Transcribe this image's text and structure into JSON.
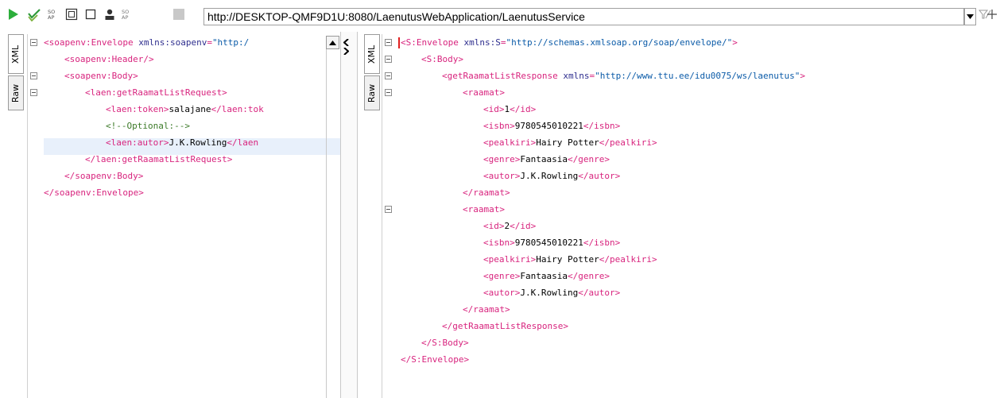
{
  "toolbar": {
    "url": "http://DESKTOP-QMF9D1U:8080/LaenutusWebApplication/LaenutusService",
    "icons": [
      "play-icon",
      "run-all-icon",
      "soap-icon",
      "xml-schema-icon",
      "square-icon",
      "user-icon",
      "soap-alt-icon",
      "stop-icon"
    ]
  },
  "request": {
    "tabs": [
      "XML",
      "Raw"
    ],
    "lines": [
      {
        "segments": [
          [
            "t",
            "<soapenv:Envelope "
          ],
          [
            "a",
            "xmlns:soapenv"
          ],
          [
            "t",
            "="
          ],
          [
            "v",
            "\"http:/"
          ]
        ]
      },
      {
        "segments": [
          [
            "t",
            "<soapenv:Header/>"
          ]
        ]
      },
      {
        "segments": [
          [
            "t",
            "<soapenv:Body>"
          ]
        ]
      },
      {
        "segments": [
          [
            "t",
            "<laen:getRaamatListRequest>"
          ]
        ]
      },
      {
        "segments": [
          [
            "t",
            "<laen:token>"
          ],
          [
            "x",
            "salajane"
          ],
          [
            "t",
            "</laen:tok"
          ]
        ]
      },
      {
        "segments": [
          [
            "c",
            "<!--Optional:-->"
          ]
        ]
      },
      {
        "segments": [
          [
            "t",
            "<laen:autor>"
          ],
          [
            "x",
            "J.K.Rowling"
          ],
          [
            "t",
            "</laen"
          ]
        ]
      },
      {
        "segments": [
          [
            "t",
            "</laen:getRaamatListRequest>"
          ]
        ]
      },
      {
        "segments": [
          [
            "t",
            "</soapenv:Body>"
          ]
        ]
      },
      {
        "segments": [
          [
            "t",
            "</soapenv:Envelope>"
          ]
        ]
      }
    ]
  },
  "response": {
    "tabs": [
      "XML",
      "Raw"
    ],
    "lines": [
      {
        "segments": [
          [
            "t",
            "<S:Envelope "
          ],
          [
            "a",
            "xmlns:S"
          ],
          [
            "t",
            "="
          ],
          [
            "v",
            "\"http://schemas.xmlsoap.org/soap/envelope/\""
          ],
          [
            "t",
            ">"
          ]
        ]
      },
      {
        "segments": [
          [
            "t",
            "<S:Body>"
          ]
        ]
      },
      {
        "segments": [
          [
            "t",
            "<getRaamatListResponse "
          ],
          [
            "a",
            "xmlns"
          ],
          [
            "t",
            "="
          ],
          [
            "v",
            "\"http://www.ttu.ee/idu0075/ws/laenutus\""
          ],
          [
            "t",
            ">"
          ]
        ]
      },
      {
        "segments": [
          [
            "t",
            "<raamat>"
          ]
        ]
      },
      {
        "segments": [
          [
            "t",
            "<id>"
          ],
          [
            "x",
            "1"
          ],
          [
            "t",
            "</id>"
          ]
        ]
      },
      {
        "segments": [
          [
            "t",
            "<isbn>"
          ],
          [
            "x",
            "9780545010221"
          ],
          [
            "t",
            "</isbn>"
          ]
        ]
      },
      {
        "segments": [
          [
            "t",
            "<pealkiri>"
          ],
          [
            "x",
            "Hairy Potter"
          ],
          [
            "t",
            "</pealkiri>"
          ]
        ]
      },
      {
        "segments": [
          [
            "t",
            "<genre>"
          ],
          [
            "x",
            "Fantaasia"
          ],
          [
            "t",
            "</genre>"
          ]
        ]
      },
      {
        "segments": [
          [
            "t",
            "<autor>"
          ],
          [
            "x",
            "J.K.Rowling"
          ],
          [
            "t",
            "</autor>"
          ]
        ]
      },
      {
        "segments": [
          [
            "t",
            "</raamat>"
          ]
        ]
      },
      {
        "segments": [
          [
            "t",
            "<raamat>"
          ]
        ]
      },
      {
        "segments": [
          [
            "t",
            "<id>"
          ],
          [
            "x",
            "2"
          ],
          [
            "t",
            "</id>"
          ]
        ]
      },
      {
        "segments": [
          [
            "t",
            "<isbn>"
          ],
          [
            "x",
            "9780545010221"
          ],
          [
            "t",
            "</isbn>"
          ]
        ]
      },
      {
        "segments": [
          [
            "t",
            "<pealkiri>"
          ],
          [
            "x",
            "Hairy Potter"
          ],
          [
            "t",
            "</pealkiri>"
          ]
        ]
      },
      {
        "segments": [
          [
            "t",
            "<genre>"
          ],
          [
            "x",
            "Fantaasia"
          ],
          [
            "t",
            "</genre>"
          ]
        ]
      },
      {
        "segments": [
          [
            "t",
            "<autor>"
          ],
          [
            "x",
            "J.K.Rowling"
          ],
          [
            "t",
            "</autor>"
          ]
        ]
      },
      {
        "segments": [
          [
            "t",
            "</raamat>"
          ]
        ]
      },
      {
        "segments": [
          [
            "t",
            "</getRaamatListResponse>"
          ]
        ]
      },
      {
        "segments": [
          [
            "t",
            "</S:Body>"
          ]
        ]
      },
      {
        "segments": [
          [
            "t",
            "</S:Envelope>"
          ]
        ]
      }
    ]
  },
  "colors": {
    "tag": "#d8247e",
    "attribute": "#2e2e8e",
    "value": "#0b5ba8",
    "text": "#000000",
    "comment": "#3c7a28",
    "highlight": "#e8f0fb"
  }
}
